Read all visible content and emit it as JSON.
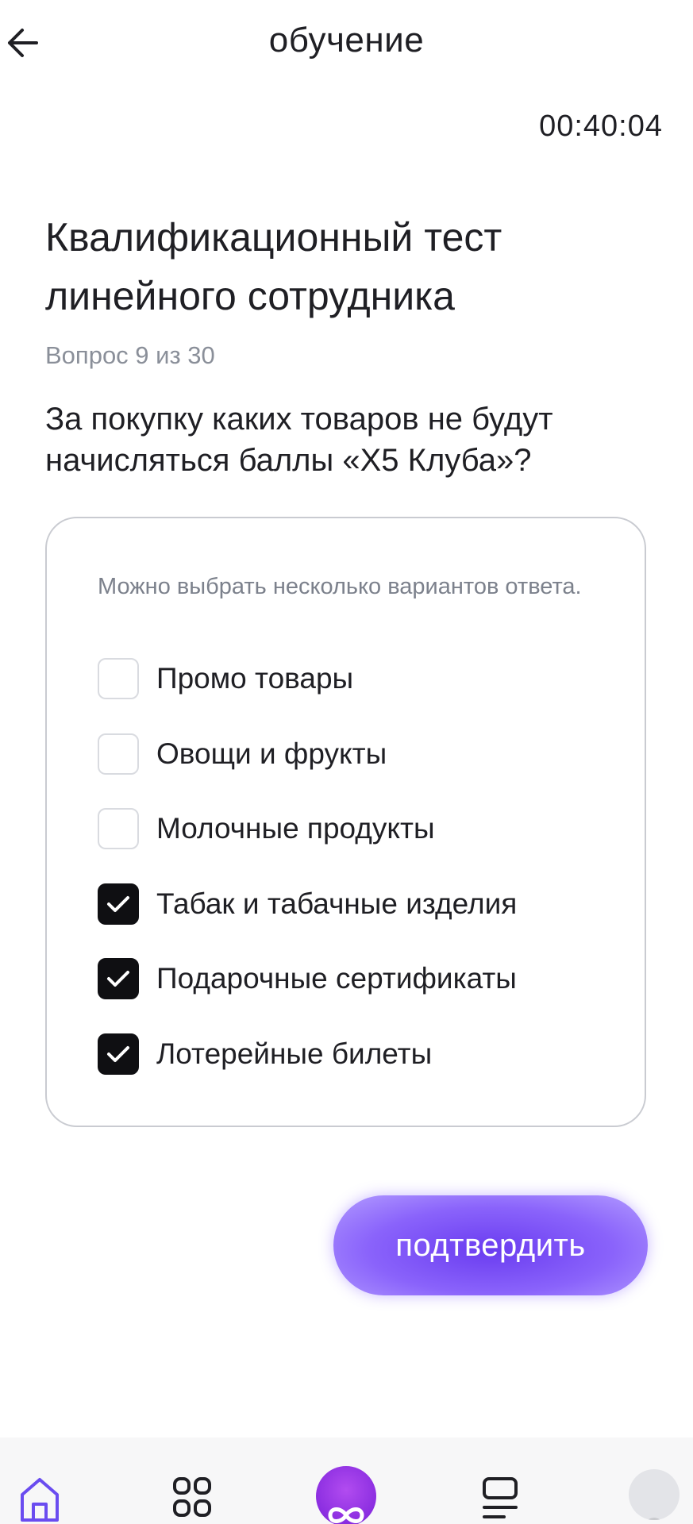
{
  "header": {
    "title": "обучение"
  },
  "timer": "00:40:04",
  "test": {
    "title": "Квалификационный тест линейного сотрудника",
    "counter": "Вопрос 9 из 30",
    "question": "За покупку каких товаров не будут начисляться баллы «X5 Клуба»?"
  },
  "answers": {
    "hint": "Можно выбрать несколько вариантов ответа.",
    "options": [
      {
        "label": "Промо товары",
        "checked": false
      },
      {
        "label": "Овощи и фрукты",
        "checked": false
      },
      {
        "label": "Молочные продукты",
        "checked": false
      },
      {
        "label": "Табак и табачные изделия",
        "checked": true
      },
      {
        "label": "Подарочные сертификаты",
        "checked": true
      },
      {
        "label": "Лотерейные билеты",
        "checked": true
      }
    ]
  },
  "confirm_label": "подтвердить",
  "colors": {
    "accent": "#7b4ff5",
    "text": "#1f1f24",
    "muted": "#8a8f99",
    "checkbox_checked": "#0f0f12",
    "tab_active": "#6a4cf0"
  },
  "tabbar": {
    "icons": [
      "home-icon",
      "catalog-grid-icon",
      "infinity-logo-icon",
      "list-icon",
      "profile-avatar-icon"
    ]
  }
}
